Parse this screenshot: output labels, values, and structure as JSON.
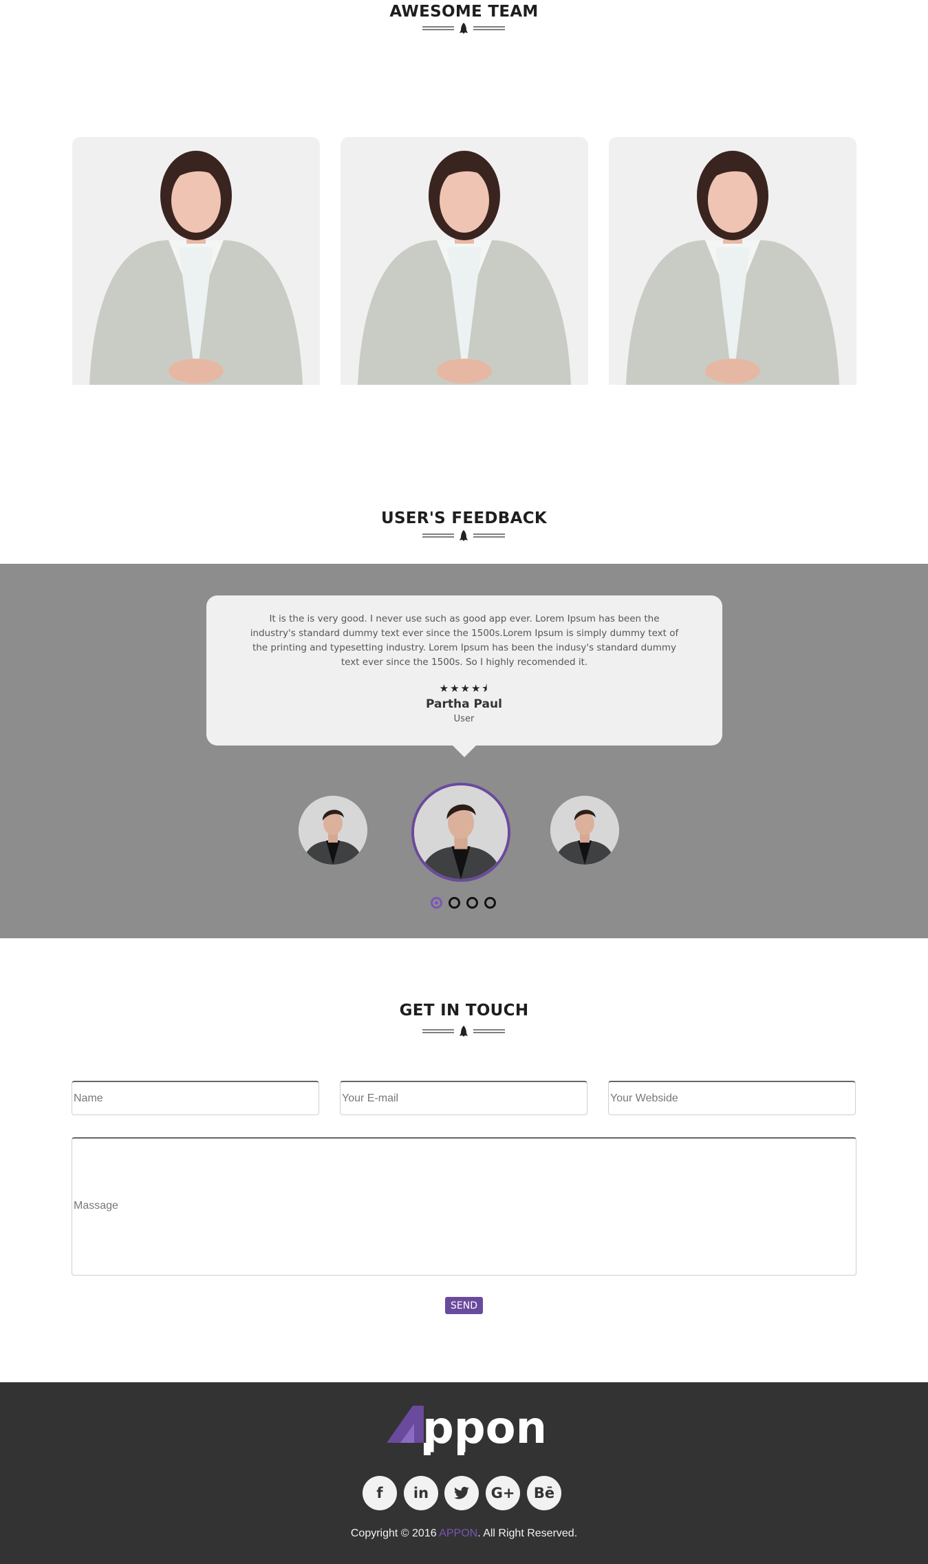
{
  "team": {
    "title": "AWESOME TEAM",
    "members": [
      {
        "photo": "woman-in-white-blazer"
      },
      {
        "photo": "woman-in-white-blazer"
      },
      {
        "photo": "woman-in-white-blazer"
      }
    ]
  },
  "feedback": {
    "title": "USER'S FEEDBACK",
    "quote": "It is the is very good. I never use such as good app ever. Lorem Ipsum has been the industry's standard dummy text ever since the 1500s.Lorem Ipsum is simply dummy text of the printing and typesetting industry. Lorem Ipsum has been the indusy's standard dummy text ever since the 1500s. So I highly recomended it.",
    "stars": "★★★★⯨",
    "rating": 4.5,
    "name": "Partha Paul",
    "role": "User",
    "active_slide": 1,
    "slide_count": 4
  },
  "contact": {
    "title": "GET IN TOUCH",
    "name_placeholder": "Name",
    "email_placeholder": "Your E-mail",
    "website_placeholder": "Your Webside",
    "message_placeholder": "Massage",
    "send_label": "SEND"
  },
  "footer": {
    "logo_text": "Appon",
    "social": [
      "facebook-icon",
      "linkedin-icon",
      "twitter-icon",
      "google-plus-icon",
      "behance-icon"
    ],
    "social_labels": [
      "f",
      "in",
      "🐦",
      "G+",
      "Bē"
    ],
    "copyright_prefix": "Copyright © 2016 ",
    "copyright_brand": "APPON",
    "copyright_suffix": ". All Right Reserved."
  },
  "colors": {
    "accent": "#6a4a9c",
    "feedback_band": "#8d8d8d",
    "footer_bg": "#333333"
  }
}
